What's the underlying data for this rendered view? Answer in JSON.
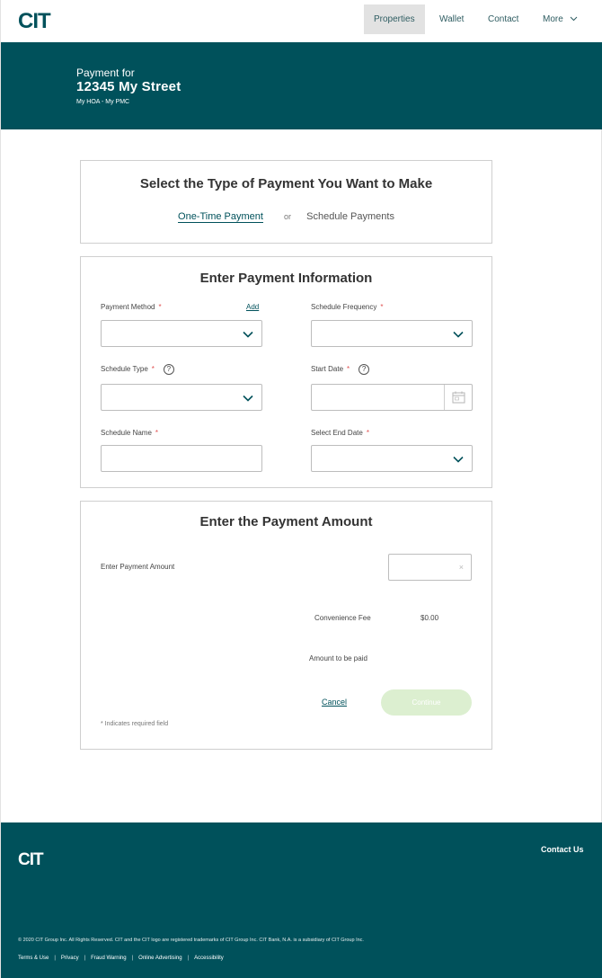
{
  "nav": {
    "logo_alt": "CIT",
    "items": [
      {
        "label": "Properties"
      },
      {
        "label": "Wallet"
      },
      {
        "label": "Contact"
      },
      {
        "label": "More"
      }
    ]
  },
  "hero": {
    "payment_for": "Payment for",
    "address": "12345 My Street",
    "hoa": "My HOA - My PMC"
  },
  "type_card": {
    "title": "Select the Type of Payment You Want to Make",
    "one_time": "One-Time Payment",
    "or": "or",
    "schedule": "Schedule Payments"
  },
  "info_card": {
    "title": "Enter Payment Information",
    "payment_method": "Payment Method",
    "add": "Add",
    "schedule_frequency": "Schedule Frequency",
    "schedule_type": "Schedule Type",
    "start_date": "Start Date",
    "schedule_name": "Schedule Name",
    "end_date": "Select End Date",
    "required_mark": "*",
    "help_mark": "?"
  },
  "amount_card": {
    "title": "Enter the Payment Amount",
    "enter_amount": "Enter Payment Amount",
    "clear_mark": "×",
    "convenience_fee_label": "Convenience Fee",
    "convenience_fee_value": "$0.00",
    "amount_to_be_paid": "Amount to be paid",
    "cancel": "Cancel",
    "continue": "Continue",
    "required_note": "* Indicates required field"
  },
  "footer": {
    "contact_us": "Contact Us",
    "copyright": "© 2020 CIT Group Inc. All Rights Reserved. CIT and the CIT logo are registered trademarks of CIT Group Inc. CIT Bank, N.A. is a subsidiary of CIT Group Inc.",
    "links": [
      "Terms & Use",
      "Privacy",
      "Fraud Warning",
      "Online Advertising",
      "Accessibility"
    ],
    "separator": "|"
  },
  "colors": {
    "brand_teal": "#00515b",
    "continue_disabled": "#dcefd0",
    "required_red": "#e05050"
  }
}
